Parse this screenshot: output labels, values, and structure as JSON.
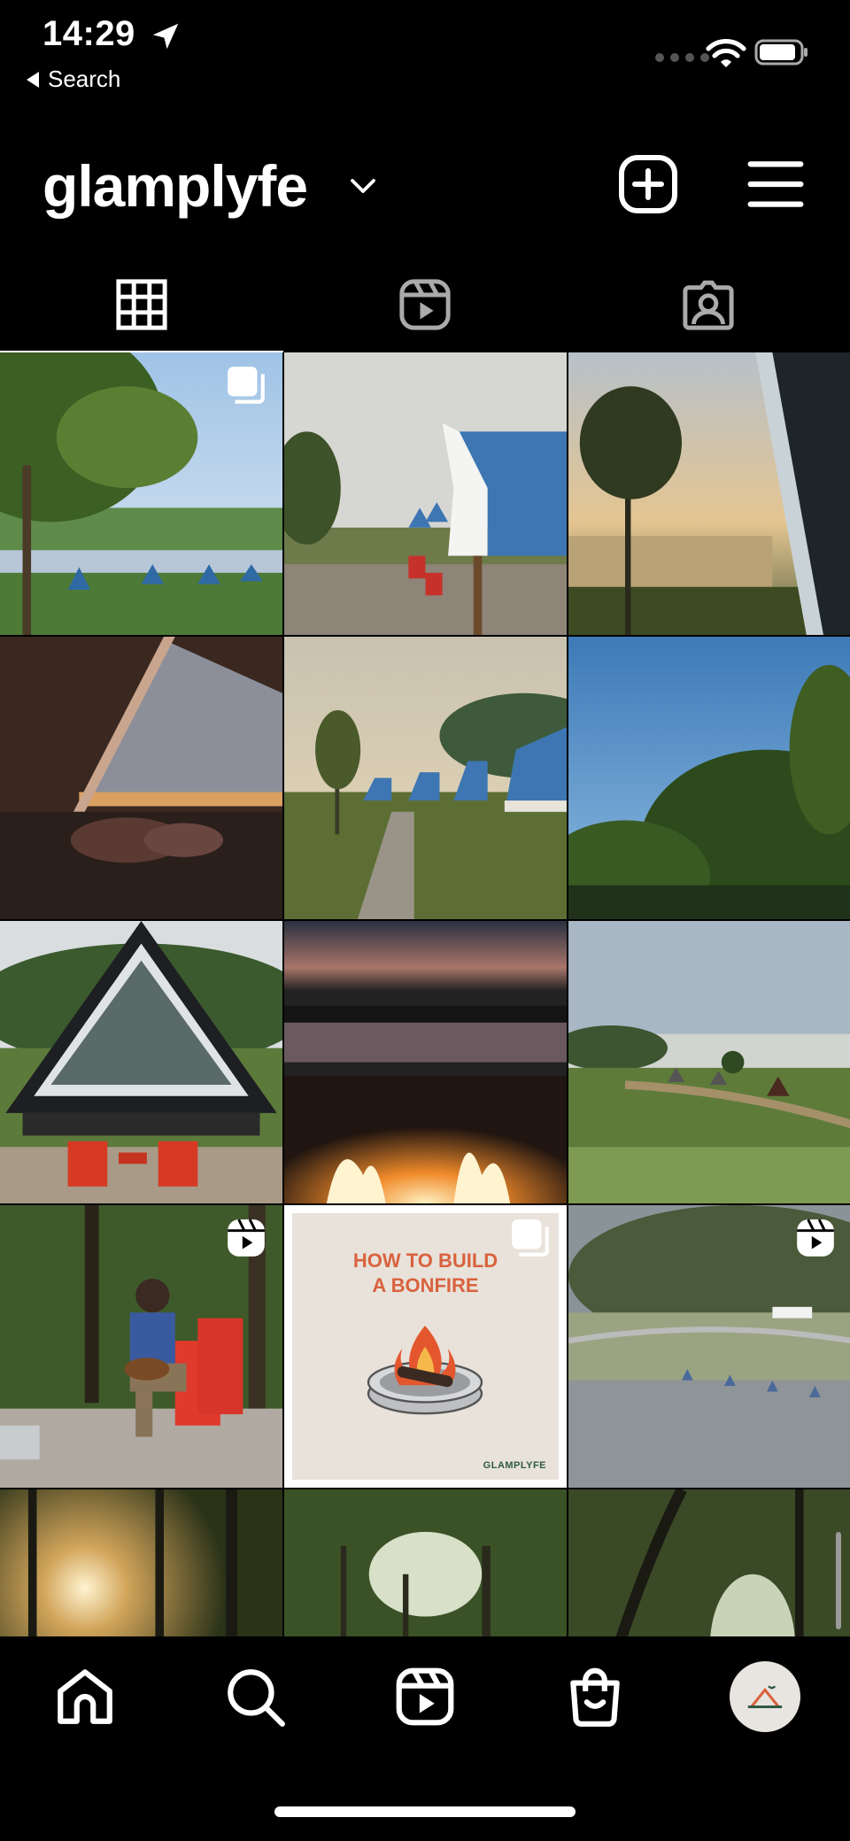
{
  "status_bar": {
    "time": "14:29",
    "back_label": "Search",
    "icons": [
      "location-arrow-icon",
      "signal-dots-icon",
      "wifi-icon",
      "battery-icon"
    ]
  },
  "header": {
    "username": "glamplyfe",
    "icons": [
      "chevron-down-icon",
      "add-post-icon",
      "menu-icon"
    ]
  },
  "tabs": [
    {
      "name": "posts-grid",
      "icon": "grid-icon",
      "active": true
    },
    {
      "name": "reels",
      "icon": "reels-icon",
      "active": false
    },
    {
      "name": "tagged",
      "icon": "tagged-icon",
      "active": false
    }
  ],
  "posts": [
    {
      "id": 1,
      "scene": "lakeside a-frame cabins under tree",
      "badge": "carousel"
    },
    {
      "id": 2,
      "scene": "blue-roof a-frame with red chairs",
      "badge": null
    },
    {
      "id": 3,
      "scene": "sunrise lake view from window",
      "badge": null
    },
    {
      "id": 4,
      "scene": "cabin interior triangle window",
      "badge": null
    },
    {
      "id": 5,
      "scene": "row of a-frame cabins at dusk",
      "badge": null
    },
    {
      "id": 6,
      "scene": "blue sky over tree line",
      "badge": null
    },
    {
      "id": 7,
      "scene": "a-frame cabin with red chairs",
      "badge": null
    },
    {
      "id": 8,
      "scene": "fire pit by lake at night",
      "badge": null
    },
    {
      "id": 9,
      "scene": "misty meadow with cabins",
      "badge": null
    },
    {
      "id": 10,
      "scene": "man playing guitar in red chair",
      "badge": "reel"
    },
    {
      "id": 11,
      "scene": "how to build a bonfire graphic",
      "badge": "carousel",
      "card_title_line1": "HOW TO BUILD",
      "card_title_line2": "A BONFIRE",
      "card_brand": "GLAMPLYFE"
    },
    {
      "id": 12,
      "scene": "aerial view of lake and cabins",
      "badge": "reel"
    },
    {
      "id": 13,
      "scene": "sun through forest",
      "badge": null
    },
    {
      "id": 14,
      "scene": "forest canopy",
      "badge": null
    },
    {
      "id": 15,
      "scene": "forest path",
      "badge": null
    }
  ],
  "bottom_nav": [
    {
      "name": "home",
      "icon": "home-icon"
    },
    {
      "name": "search",
      "icon": "search-icon"
    },
    {
      "name": "reels",
      "icon": "reels-icon"
    },
    {
      "name": "shop",
      "icon": "shop-bag-icon"
    },
    {
      "name": "profile",
      "icon": "profile-avatar-icon"
    }
  ]
}
